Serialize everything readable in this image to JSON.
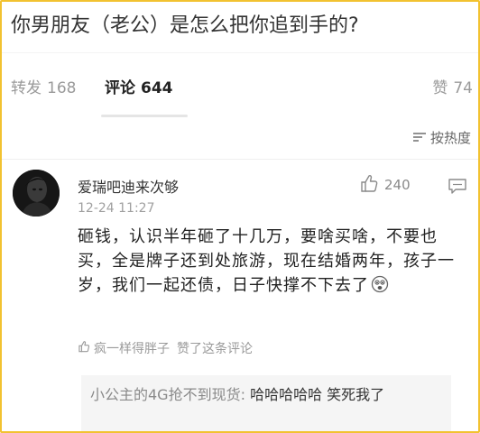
{
  "question": {
    "title": "你男朋友（老公）是怎么把你追到手的?"
  },
  "tabs": {
    "repost": {
      "label": "转发",
      "count": "168"
    },
    "comment": {
      "label": "评论",
      "count": "644"
    },
    "like": {
      "label": "赞",
      "count": "74"
    }
  },
  "sort": {
    "label": "按热度"
  },
  "comment": {
    "username": "爱瑞吧迪来次够",
    "time": "12-24 11:27",
    "like_count": "240",
    "text": "砸钱，认识半年砸了十几万，要啥买啥，不要也买，全是牌子还到处旅游，现在结婚两年，孩子一岁，我们一起还债，日子快撑不下去了",
    "liked_by_user": "疯一样得胖子",
    "liked_by_suffix": "赞了这条评论"
  },
  "reply": {
    "user": "小公主的4G抢不到现货:",
    "text": "哈哈哈哈哈 笑死我了"
  },
  "colors": {
    "frame": "#f2c230",
    "muted": "#9a9a9a",
    "text": "#222222"
  },
  "icons": [
    "sort-icon",
    "thumbs-up-icon",
    "reply-icon",
    "emoji-icon",
    "small-thumbs-up-icon"
  ]
}
